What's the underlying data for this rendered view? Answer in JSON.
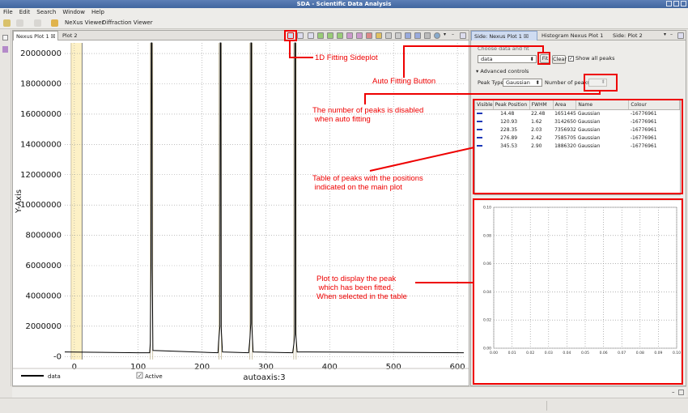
{
  "window": {
    "title": "SDA - Scientific Data Analysis"
  },
  "menu": [
    "File",
    "Edit",
    "Search",
    "Window",
    "Help"
  ],
  "toolbar": {
    "perspectives": [
      "NeXus Viewer",
      "Diffraction Viewer"
    ]
  },
  "main_tabs": [
    {
      "label": "Nexus Plot 1 ☒"
    },
    {
      "label": "Plot 2"
    }
  ],
  "side_tabs": [
    {
      "label": "Side: Nexus Plot 1 ☒"
    },
    {
      "label": "Histogram Nexus Plot 1"
    },
    {
      "label": "Side: Plot 2"
    }
  ],
  "chart_data": {
    "type": "line",
    "xlabel": "autoaxis:3",
    "ylabel": "Y-Axis",
    "xlim": [
      -15,
      610
    ],
    "ylim": [
      -200000,
      20700000
    ],
    "x_ticks": [
      0,
      100,
      200,
      300,
      400,
      500,
      600
    ],
    "y_ticks": [
      {
        "v": 20000000,
        "label": "20000000"
      },
      {
        "v": 18000000,
        "label": "18000000"
      },
      {
        "v": 16000000,
        "label": "16000000"
      },
      {
        "v": 14000000,
        "label": "14000000"
      },
      {
        "v": 12000000,
        "label": "12000000"
      },
      {
        "v": 10000000,
        "label": "10000000"
      },
      {
        "v": 8000000,
        "label": "8000000"
      },
      {
        "v": 6000000,
        "label": "6000000"
      },
      {
        "v": 4000000,
        "label": "4000000"
      },
      {
        "v": 2000000,
        "label": "2000000"
      },
      {
        "v": 0,
        "label": "-0"
      }
    ],
    "grid": true,
    "region": [
      -5,
      12
    ],
    "series": [
      {
        "name": "data",
        "points": [
          [
            -15,
            300000
          ],
          [
            100,
            250000
          ],
          [
            118,
            250000
          ],
          [
            119,
            900000
          ],
          [
            120,
            6000000
          ],
          [
            120.5,
            20700000
          ],
          [
            121.5,
            20700000
          ],
          [
            122,
            5800000
          ],
          [
            123,
            400000
          ],
          [
            225,
            250000
          ],
          [
            226,
            1000000
          ],
          [
            228,
            2000000
          ],
          [
            228.5,
            20700000
          ],
          [
            229.5,
            20700000
          ],
          [
            230,
            1900000
          ],
          [
            232,
            300000
          ],
          [
            273,
            250000
          ],
          [
            275,
            1200000
          ],
          [
            276.3,
            2200000
          ],
          [
            276.6,
            20700000
          ],
          [
            277.6,
            20700000
          ],
          [
            278,
            2100000
          ],
          [
            280,
            300000
          ],
          [
            342,
            250000
          ],
          [
            344,
            900000
          ],
          [
            345.2,
            1500000
          ],
          [
            345.4,
            20700000
          ],
          [
            346.4,
            20700000
          ],
          [
            346.8,
            1500000
          ],
          [
            349,
            300000
          ],
          [
            610,
            250000
          ]
        ]
      }
    ],
    "peak_markers": [
      120.93,
      228.35,
      276.89,
      345.53
    ],
    "legend": [
      {
        "name": "data"
      },
      {
        "name": "Active",
        "checked": true
      }
    ]
  },
  "side": {
    "choose_label": "Choose data and fit",
    "data_select": "data",
    "fit_button": "Fit",
    "clear_button": "Clear",
    "show_all_label": "Show all peaks",
    "advanced_label": "Advanced controls",
    "peak_type_label": "Peak Type",
    "peak_type_value": "Gaussian",
    "num_peaks_label": "Number of peaks",
    "peak_table": {
      "columns": [
        "Visible",
        "Peak Position",
        "FWHM",
        "Area",
        "Name",
        "Colour"
      ],
      "rows": [
        {
          "position": "14.48",
          "fwhm": "22.48",
          "area": "1651445",
          "name": "Gaussian",
          "colour": "-16776961"
        },
        {
          "position": "120.93",
          "fwhm": "1.62",
          "area": "3142650",
          "name": "Gaussian",
          "colour": "-16776961"
        },
        {
          "position": "228.35",
          "fwhm": "2.03",
          "area": "7356932",
          "name": "Gaussian",
          "colour": "-16776961"
        },
        {
          "position": "276.89",
          "fwhm": "2.42",
          "area": "7585705",
          "name": "Gaussian",
          "colour": "-16776961"
        },
        {
          "position": "345.53",
          "fwhm": "2.90",
          "area": "1886320",
          "name": "Gaussian",
          "colour": "-16776961"
        }
      ]
    },
    "fit_plot": {
      "xlim": [
        0,
        0.1
      ],
      "ylim": [
        0,
        0.1
      ],
      "x_ticks": [
        "0.00",
        "0.01",
        "0.02",
        "0.03",
        "0.04",
        "0.05",
        "0.06",
        "0.07",
        "0.08",
        "0.09",
        "0.10"
      ],
      "y_ticks": [
        "0.10",
        "0.08",
        "0.06",
        "0.04",
        "0.02",
        "0.00"
      ]
    }
  },
  "annotations": [
    {
      "key": "sideplot",
      "text": "1D Fitting Sideplot"
    },
    {
      "key": "autofit",
      "text": "Auto Fitting Button"
    },
    {
      "key": "numpeaks",
      "text": "The number of peaks is disabled\n when auto fitting"
    },
    {
      "key": "table",
      "text": "Table of peaks with the positions\n indicated on the main plot"
    },
    {
      "key": "fitplot",
      "text": "Plot to display the peak\n which has been fitted,\nWhen selected in the table"
    }
  ],
  "colors": {
    "annotation": "#e00000",
    "data_line": "#000000",
    "peak_marker": "#b8ac86",
    "region": "#fdf1c6",
    "peak_visible": "#1a37b8"
  }
}
